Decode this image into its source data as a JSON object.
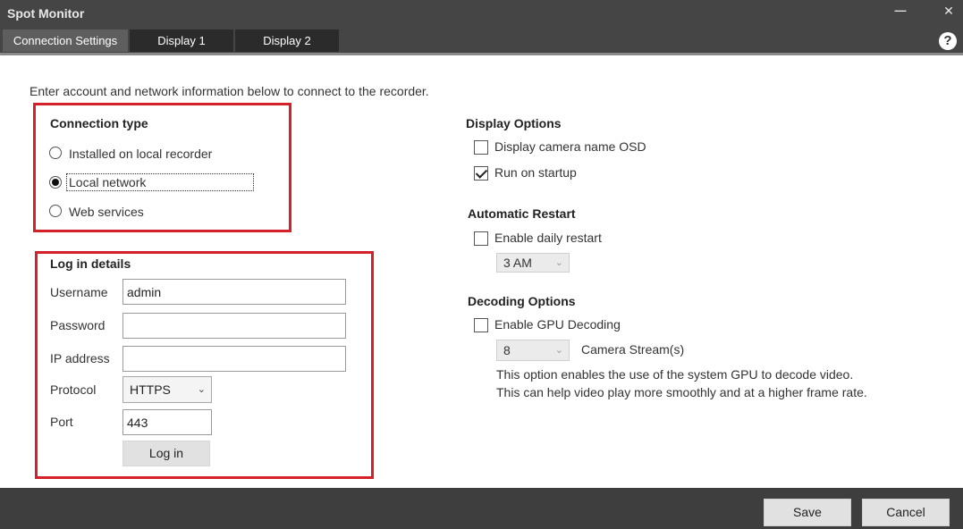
{
  "window": {
    "title": "Spot Monitor",
    "minimize_icon": "minimize-icon",
    "close_icon": "close-icon",
    "help_icon": "help-icon"
  },
  "tabs": [
    {
      "label": "Connection Settings",
      "active": true
    },
    {
      "label": "Display 1",
      "active": false
    },
    {
      "label": "Display 2",
      "active": false
    }
  ],
  "intro_text": "Enter account and network information below to connect to the recorder.",
  "connection_type": {
    "heading": "Connection type",
    "options": [
      {
        "label": "Installed on local recorder",
        "selected": false
      },
      {
        "label": "Local network",
        "selected": true
      },
      {
        "label": "Web services",
        "selected": false
      }
    ]
  },
  "login": {
    "heading": "Log in details",
    "username_label": "Username",
    "username_value": "admin",
    "password_label": "Password",
    "password_value": "",
    "ip_label": "IP address",
    "ip_value": "",
    "protocol_label": "Protocol",
    "protocol_value": "HTTPS",
    "port_label": "Port",
    "port_value": "443",
    "login_button": "Log in"
  },
  "display_options": {
    "heading": "Display Options",
    "camera_name_osd": {
      "label": "Display camera name OSD",
      "checked": false
    },
    "run_on_startup": {
      "label": "Run on startup",
      "checked": true
    }
  },
  "automatic_restart": {
    "heading": "Automatic Restart",
    "daily_restart": {
      "label": "Enable daily restart",
      "checked": false
    },
    "time_value": "3 AM"
  },
  "decoding_options": {
    "heading": "Decoding Options",
    "gpu_decoding": {
      "label": "Enable GPU Decoding",
      "checked": false
    },
    "stream_count": "8",
    "stream_label": "Camera Stream(s)",
    "info_line1": "This option enables the use of the system GPU to decode video.",
    "info_line2": "This can help video play more smoothly and at a higher frame rate."
  },
  "footer": {
    "save_label": "Save",
    "cancel_label": "Cancel"
  },
  "colors": {
    "titlebar": "#454545",
    "active_tab": "#5e5e5e",
    "inactive_tab": "#2b2b2b",
    "highlight_box": "#d32029",
    "footer": "#3e3e3e"
  }
}
